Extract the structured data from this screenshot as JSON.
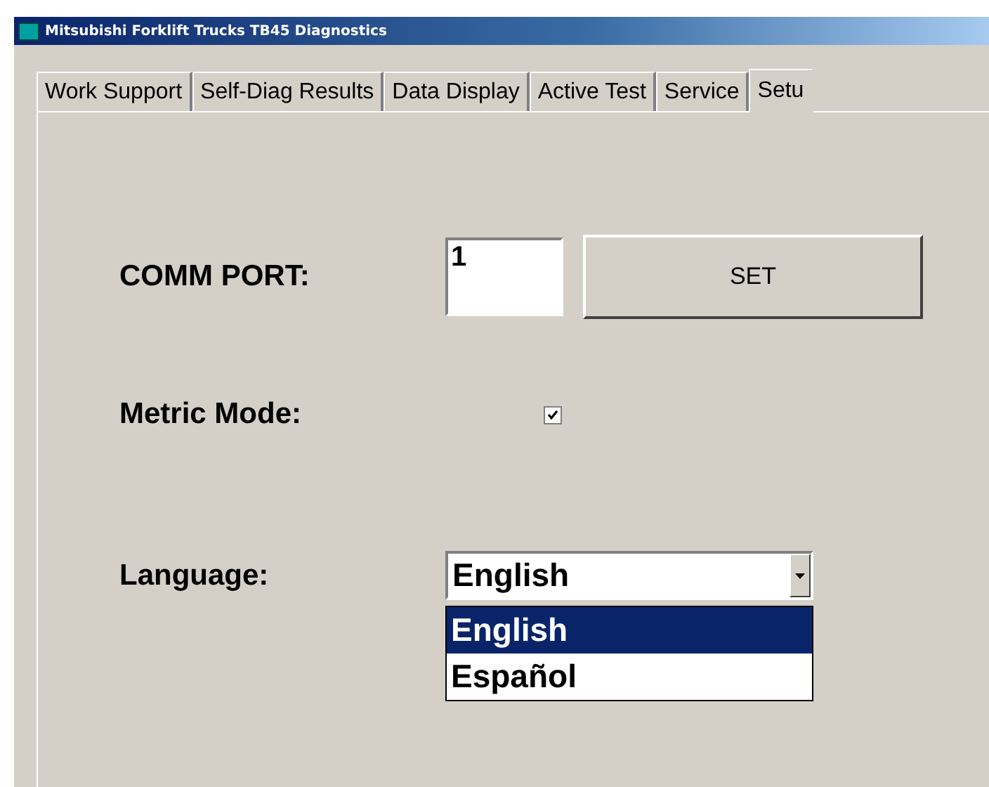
{
  "window": {
    "title": "Mitsubishi Forklift Trucks TB45 Diagnostics"
  },
  "tabs": [
    {
      "label": "Work Support",
      "selected": false
    },
    {
      "label": "Self-Diag Results",
      "selected": false
    },
    {
      "label": "Data Display",
      "selected": false
    },
    {
      "label": "Active Test",
      "selected": false
    },
    {
      "label": "Service",
      "selected": false
    },
    {
      "label": "Setu",
      "selected": true
    }
  ],
  "comm_port": {
    "label": "COMM PORT:",
    "value": "1",
    "button": "SET"
  },
  "metric_mode": {
    "label": "Metric Mode:",
    "checked": true
  },
  "language": {
    "label": "Language:",
    "value": "English",
    "expanded": true,
    "options": [
      {
        "label": "English",
        "selected": true
      },
      {
        "label": "Español",
        "selected": false
      }
    ]
  }
}
